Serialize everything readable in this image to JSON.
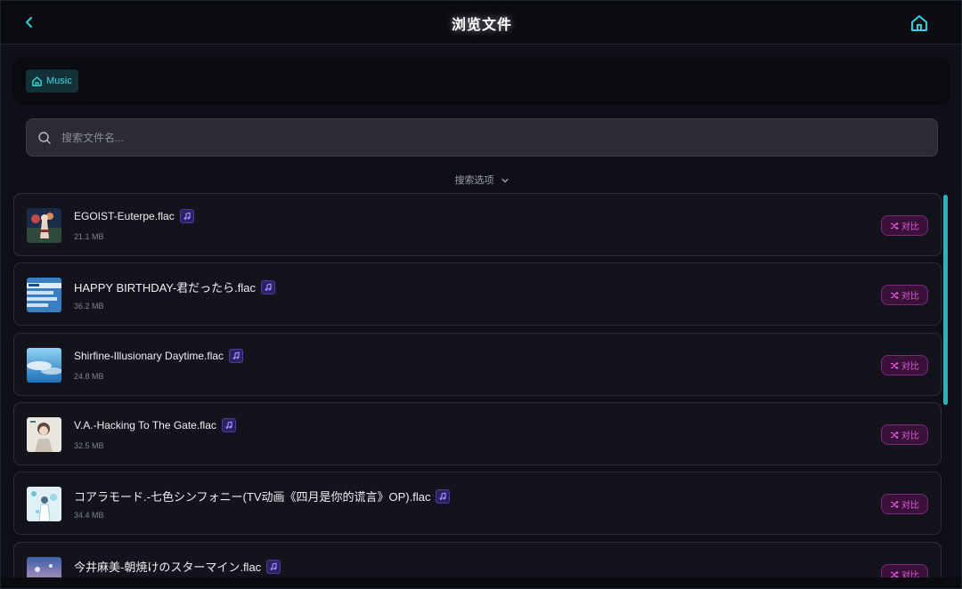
{
  "header": {
    "title": "浏览文件",
    "back_icon": "chevron-left-icon",
    "home_icon": "home-icon",
    "accent_color": "#2fd0db"
  },
  "breadcrumb": {
    "items": [
      {
        "label": "Music",
        "icon": "home-icon"
      }
    ]
  },
  "search": {
    "placeholder": "搜索文件名...",
    "value": "",
    "icon": "search-icon"
  },
  "search_options": {
    "label": "搜索选项",
    "icon": "chevron-down-icon"
  },
  "files": [
    {
      "name": "EGOIST-Euterpe.flac",
      "size": "21.1 MB",
      "type_icon": "music-note-icon",
      "compare_label": "对比"
    },
    {
      "name": "HAPPY BIRTHDAY-君だったら.flac",
      "size": "36.2 MB",
      "type_icon": "music-note-icon",
      "compare_label": "对比"
    },
    {
      "name": "Shirfine-Illusionary Daytime.flac",
      "size": "24.8 MB",
      "type_icon": "music-note-icon",
      "compare_label": "对比"
    },
    {
      "name": "V.A.-Hacking To The Gate.flac",
      "size": "32.5 MB",
      "type_icon": "music-note-icon",
      "compare_label": "对比"
    },
    {
      "name": "コアラモード.-七色シンフォニー(TV动画《四月是你的谎言》OP).flac",
      "size": "34.4 MB",
      "type_icon": "music-note-icon",
      "compare_label": "对比"
    },
    {
      "name": "今井麻美-朝焼けのスターマイン.flac",
      "size": "",
      "type_icon": "music-note-icon",
      "compare_label": "对比"
    }
  ],
  "colors": {
    "compare_bg": "#3a1239",
    "compare_text": "#e05ad9",
    "badge_bg": "#2b2261",
    "scrollbar": "#2bb3bd"
  }
}
